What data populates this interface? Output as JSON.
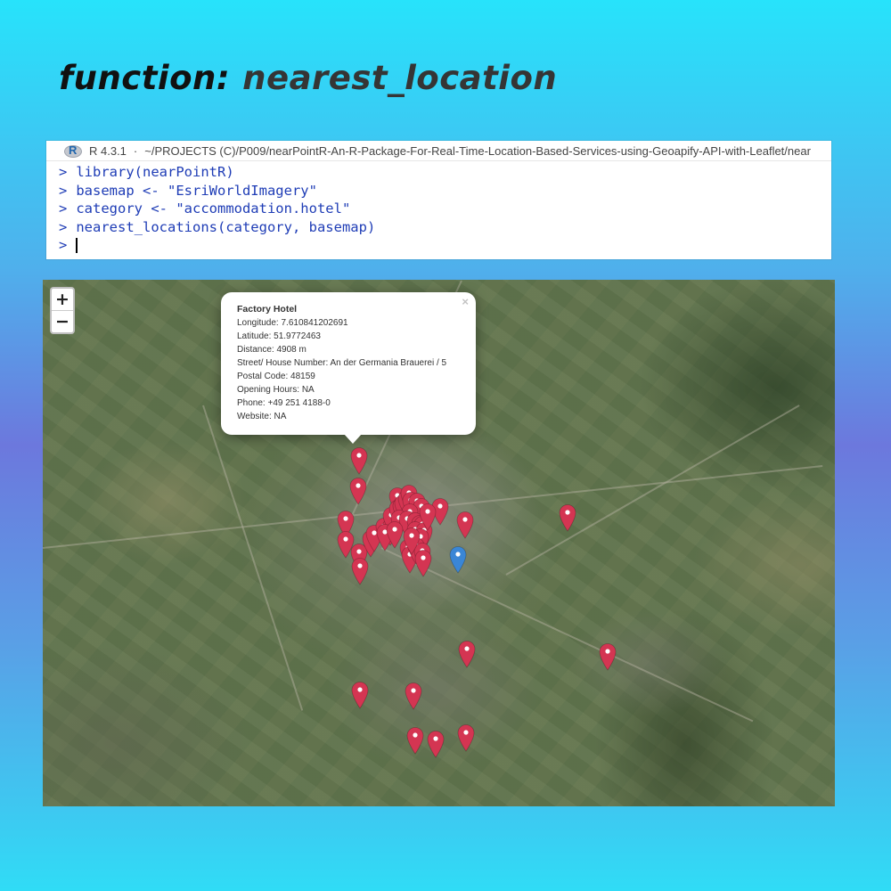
{
  "headline": {
    "keyword": "function:",
    "name": "nearest_location"
  },
  "console": {
    "version": "R 4.3.1",
    "separator": "·",
    "path": "~/PROJECTS (C)/P009/nearPointR-An-R-Package-For-Real-Time-Location-Based-Services-using-Geoapify-API-with-Leaflet/near",
    "prompt": ">",
    "lines": [
      "library(nearPointR)",
      "basemap <- \"EsriWorldImagery\"",
      "category <- \"accommodation.hotel\"",
      "nearest_locations(category, basemap)"
    ]
  },
  "map": {
    "zoom_in_label": "+",
    "zoom_out_label": "−",
    "popup": {
      "close_label": "×",
      "title": "Factory Hotel",
      "fields": [
        "Longitude: 7.610841202691",
        "Latitude: 51.9772463",
        "Distance: 4908 m",
        "Street/ House Number: An der Germania Brauerei / 5",
        "Postal Code: 48159",
        "Opening Hours: NA",
        "Phone: +49 251 4188-0",
        "Website: NA"
      ]
    },
    "colors": {
      "hotel_marker": "#d43552",
      "user_marker": "#3a86d6"
    },
    "icons": {
      "hotel": "map-pin-icon",
      "user": "map-pin-icon"
    }
  }
}
